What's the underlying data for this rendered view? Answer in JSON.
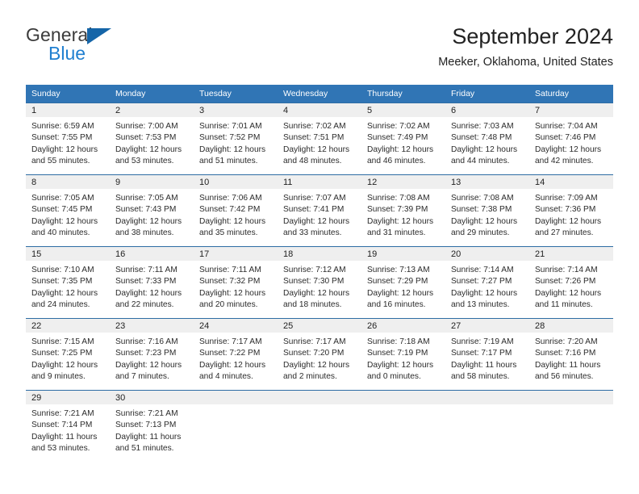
{
  "brand": {
    "name_top": "General",
    "name_bottom": "Blue",
    "color_primary": "#1f7fd0",
    "color_flag": "#1565a8"
  },
  "header": {
    "title": "September 2024",
    "subtitle": "Meeker, Oklahoma, United States"
  },
  "calendar": {
    "header_bg": "#3075b5",
    "row_border": "#2e6da4",
    "daynum_bg": "#efefef",
    "weekdays": [
      "Sunday",
      "Monday",
      "Tuesday",
      "Wednesday",
      "Thursday",
      "Friday",
      "Saturday"
    ],
    "weeks": [
      [
        {
          "day": "1",
          "sunrise": "Sunrise: 6:59 AM",
          "sunset": "Sunset: 7:55 PM",
          "daylight_line1": "Daylight: 12 hours",
          "daylight_line2": "and 55 minutes."
        },
        {
          "day": "2",
          "sunrise": "Sunrise: 7:00 AM",
          "sunset": "Sunset: 7:53 PM",
          "daylight_line1": "Daylight: 12 hours",
          "daylight_line2": "and 53 minutes."
        },
        {
          "day": "3",
          "sunrise": "Sunrise: 7:01 AM",
          "sunset": "Sunset: 7:52 PM",
          "daylight_line1": "Daylight: 12 hours",
          "daylight_line2": "and 51 minutes."
        },
        {
          "day": "4",
          "sunrise": "Sunrise: 7:02 AM",
          "sunset": "Sunset: 7:51 PM",
          "daylight_line1": "Daylight: 12 hours",
          "daylight_line2": "and 48 minutes."
        },
        {
          "day": "5",
          "sunrise": "Sunrise: 7:02 AM",
          "sunset": "Sunset: 7:49 PM",
          "daylight_line1": "Daylight: 12 hours",
          "daylight_line2": "and 46 minutes."
        },
        {
          "day": "6",
          "sunrise": "Sunrise: 7:03 AM",
          "sunset": "Sunset: 7:48 PM",
          "daylight_line1": "Daylight: 12 hours",
          "daylight_line2": "and 44 minutes."
        },
        {
          "day": "7",
          "sunrise": "Sunrise: 7:04 AM",
          "sunset": "Sunset: 7:46 PM",
          "daylight_line1": "Daylight: 12 hours",
          "daylight_line2": "and 42 minutes."
        }
      ],
      [
        {
          "day": "8",
          "sunrise": "Sunrise: 7:05 AM",
          "sunset": "Sunset: 7:45 PM",
          "daylight_line1": "Daylight: 12 hours",
          "daylight_line2": "and 40 minutes."
        },
        {
          "day": "9",
          "sunrise": "Sunrise: 7:05 AM",
          "sunset": "Sunset: 7:43 PM",
          "daylight_line1": "Daylight: 12 hours",
          "daylight_line2": "and 38 minutes."
        },
        {
          "day": "10",
          "sunrise": "Sunrise: 7:06 AM",
          "sunset": "Sunset: 7:42 PM",
          "daylight_line1": "Daylight: 12 hours",
          "daylight_line2": "and 35 minutes."
        },
        {
          "day": "11",
          "sunrise": "Sunrise: 7:07 AM",
          "sunset": "Sunset: 7:41 PM",
          "daylight_line1": "Daylight: 12 hours",
          "daylight_line2": "and 33 minutes."
        },
        {
          "day": "12",
          "sunrise": "Sunrise: 7:08 AM",
          "sunset": "Sunset: 7:39 PM",
          "daylight_line1": "Daylight: 12 hours",
          "daylight_line2": "and 31 minutes."
        },
        {
          "day": "13",
          "sunrise": "Sunrise: 7:08 AM",
          "sunset": "Sunset: 7:38 PM",
          "daylight_line1": "Daylight: 12 hours",
          "daylight_line2": "and 29 minutes."
        },
        {
          "day": "14",
          "sunrise": "Sunrise: 7:09 AM",
          "sunset": "Sunset: 7:36 PM",
          "daylight_line1": "Daylight: 12 hours",
          "daylight_line2": "and 27 minutes."
        }
      ],
      [
        {
          "day": "15",
          "sunrise": "Sunrise: 7:10 AM",
          "sunset": "Sunset: 7:35 PM",
          "daylight_line1": "Daylight: 12 hours",
          "daylight_line2": "and 24 minutes."
        },
        {
          "day": "16",
          "sunrise": "Sunrise: 7:11 AM",
          "sunset": "Sunset: 7:33 PM",
          "daylight_line1": "Daylight: 12 hours",
          "daylight_line2": "and 22 minutes."
        },
        {
          "day": "17",
          "sunrise": "Sunrise: 7:11 AM",
          "sunset": "Sunset: 7:32 PM",
          "daylight_line1": "Daylight: 12 hours",
          "daylight_line2": "and 20 minutes."
        },
        {
          "day": "18",
          "sunrise": "Sunrise: 7:12 AM",
          "sunset": "Sunset: 7:30 PM",
          "daylight_line1": "Daylight: 12 hours",
          "daylight_line2": "and 18 minutes."
        },
        {
          "day": "19",
          "sunrise": "Sunrise: 7:13 AM",
          "sunset": "Sunset: 7:29 PM",
          "daylight_line1": "Daylight: 12 hours",
          "daylight_line2": "and 16 minutes."
        },
        {
          "day": "20",
          "sunrise": "Sunrise: 7:14 AM",
          "sunset": "Sunset: 7:27 PM",
          "daylight_line1": "Daylight: 12 hours",
          "daylight_line2": "and 13 minutes."
        },
        {
          "day": "21",
          "sunrise": "Sunrise: 7:14 AM",
          "sunset": "Sunset: 7:26 PM",
          "daylight_line1": "Daylight: 12 hours",
          "daylight_line2": "and 11 minutes."
        }
      ],
      [
        {
          "day": "22",
          "sunrise": "Sunrise: 7:15 AM",
          "sunset": "Sunset: 7:25 PM",
          "daylight_line1": "Daylight: 12 hours",
          "daylight_line2": "and 9 minutes."
        },
        {
          "day": "23",
          "sunrise": "Sunrise: 7:16 AM",
          "sunset": "Sunset: 7:23 PM",
          "daylight_line1": "Daylight: 12 hours",
          "daylight_line2": "and 7 minutes."
        },
        {
          "day": "24",
          "sunrise": "Sunrise: 7:17 AM",
          "sunset": "Sunset: 7:22 PM",
          "daylight_line1": "Daylight: 12 hours",
          "daylight_line2": "and 4 minutes."
        },
        {
          "day": "25",
          "sunrise": "Sunrise: 7:17 AM",
          "sunset": "Sunset: 7:20 PM",
          "daylight_line1": "Daylight: 12 hours",
          "daylight_line2": "and 2 minutes."
        },
        {
          "day": "26",
          "sunrise": "Sunrise: 7:18 AM",
          "sunset": "Sunset: 7:19 PM",
          "daylight_line1": "Daylight: 12 hours",
          "daylight_line2": "and 0 minutes."
        },
        {
          "day": "27",
          "sunrise": "Sunrise: 7:19 AM",
          "sunset": "Sunset: 7:17 PM",
          "daylight_line1": "Daylight: 11 hours",
          "daylight_line2": "and 58 minutes."
        },
        {
          "day": "28",
          "sunrise": "Sunrise: 7:20 AM",
          "sunset": "Sunset: 7:16 PM",
          "daylight_line1": "Daylight: 11 hours",
          "daylight_line2": "and 56 minutes."
        }
      ],
      [
        {
          "day": "29",
          "sunrise": "Sunrise: 7:21 AM",
          "sunset": "Sunset: 7:14 PM",
          "daylight_line1": "Daylight: 11 hours",
          "daylight_line2": "and 53 minutes."
        },
        {
          "day": "30",
          "sunrise": "Sunrise: 7:21 AM",
          "sunset": "Sunset: 7:13 PM",
          "daylight_line1": "Daylight: 11 hours",
          "daylight_line2": "and 51 minutes."
        },
        {
          "day": "",
          "sunrise": "",
          "sunset": "",
          "daylight_line1": "",
          "daylight_line2": ""
        },
        {
          "day": "",
          "sunrise": "",
          "sunset": "",
          "daylight_line1": "",
          "daylight_line2": ""
        },
        {
          "day": "",
          "sunrise": "",
          "sunset": "",
          "daylight_line1": "",
          "daylight_line2": ""
        },
        {
          "day": "",
          "sunrise": "",
          "sunset": "",
          "daylight_line1": "",
          "daylight_line2": ""
        },
        {
          "day": "",
          "sunrise": "",
          "sunset": "",
          "daylight_line1": "",
          "daylight_line2": ""
        }
      ]
    ]
  }
}
